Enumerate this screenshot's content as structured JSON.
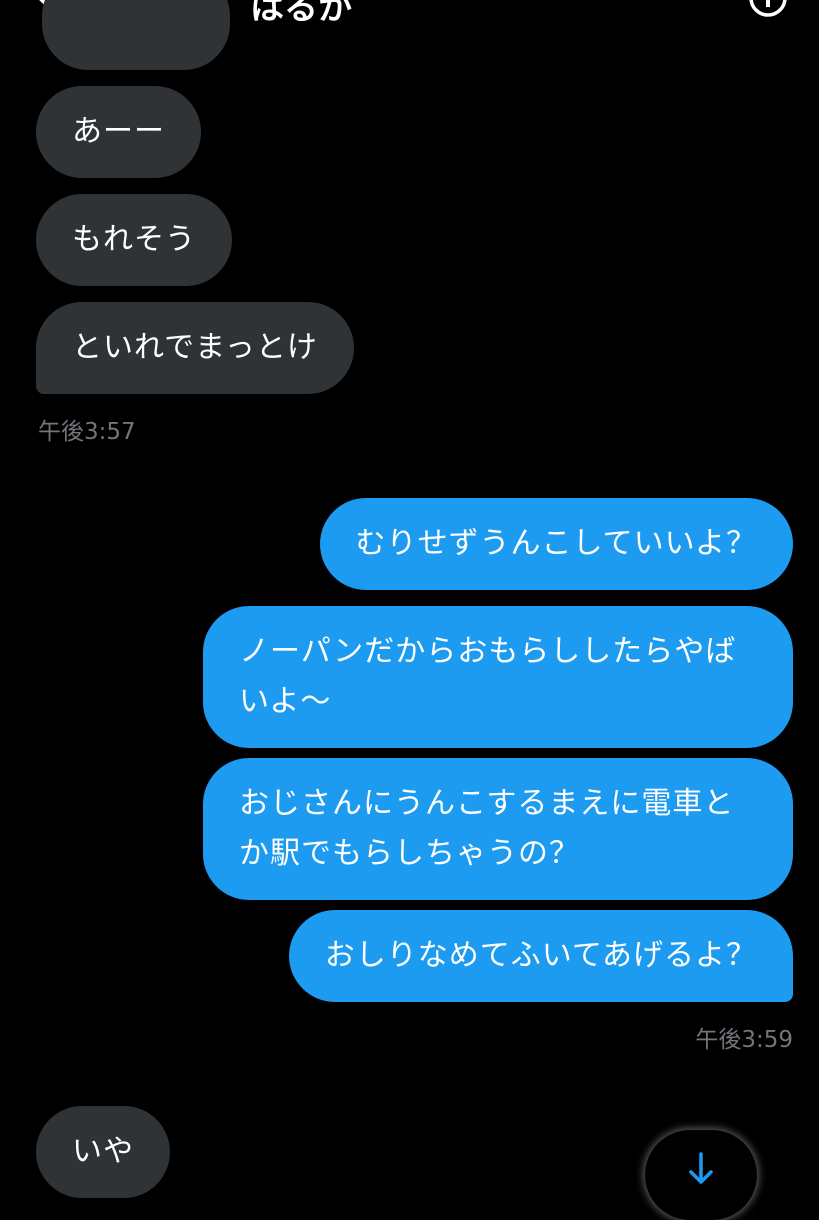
{
  "header": {
    "contact_name": "はるか",
    "back_icon": "chevron-left-icon",
    "info_icon": "info-icon"
  },
  "messages": {
    "m0": "",
    "m1": "あーー",
    "m2": "もれそう",
    "m3": "といれでまっとけ",
    "t1": "午後3:57",
    "s1": "むりせずうんこしていいよ？",
    "s2_line1": "ノーパンだからおもらししたらやば",
    "s2_line2": "いよ〜",
    "s3_line1": "おじさんにうんこするまえに電車と",
    "s3_line2": "か駅でもらしちゃうの？",
    "s4": "おしりなめてふいてあげるよ？",
    "t2": "午後3:59",
    "m4": "いや"
  },
  "colors": {
    "background": "#000000",
    "received_bubble": "#2f3336",
    "sent_bubble": "#1d9bf0",
    "timestamp": "#71767b",
    "accent": "#1d9bf0"
  },
  "scroll_button": {
    "icon": "arrow-down-icon"
  }
}
